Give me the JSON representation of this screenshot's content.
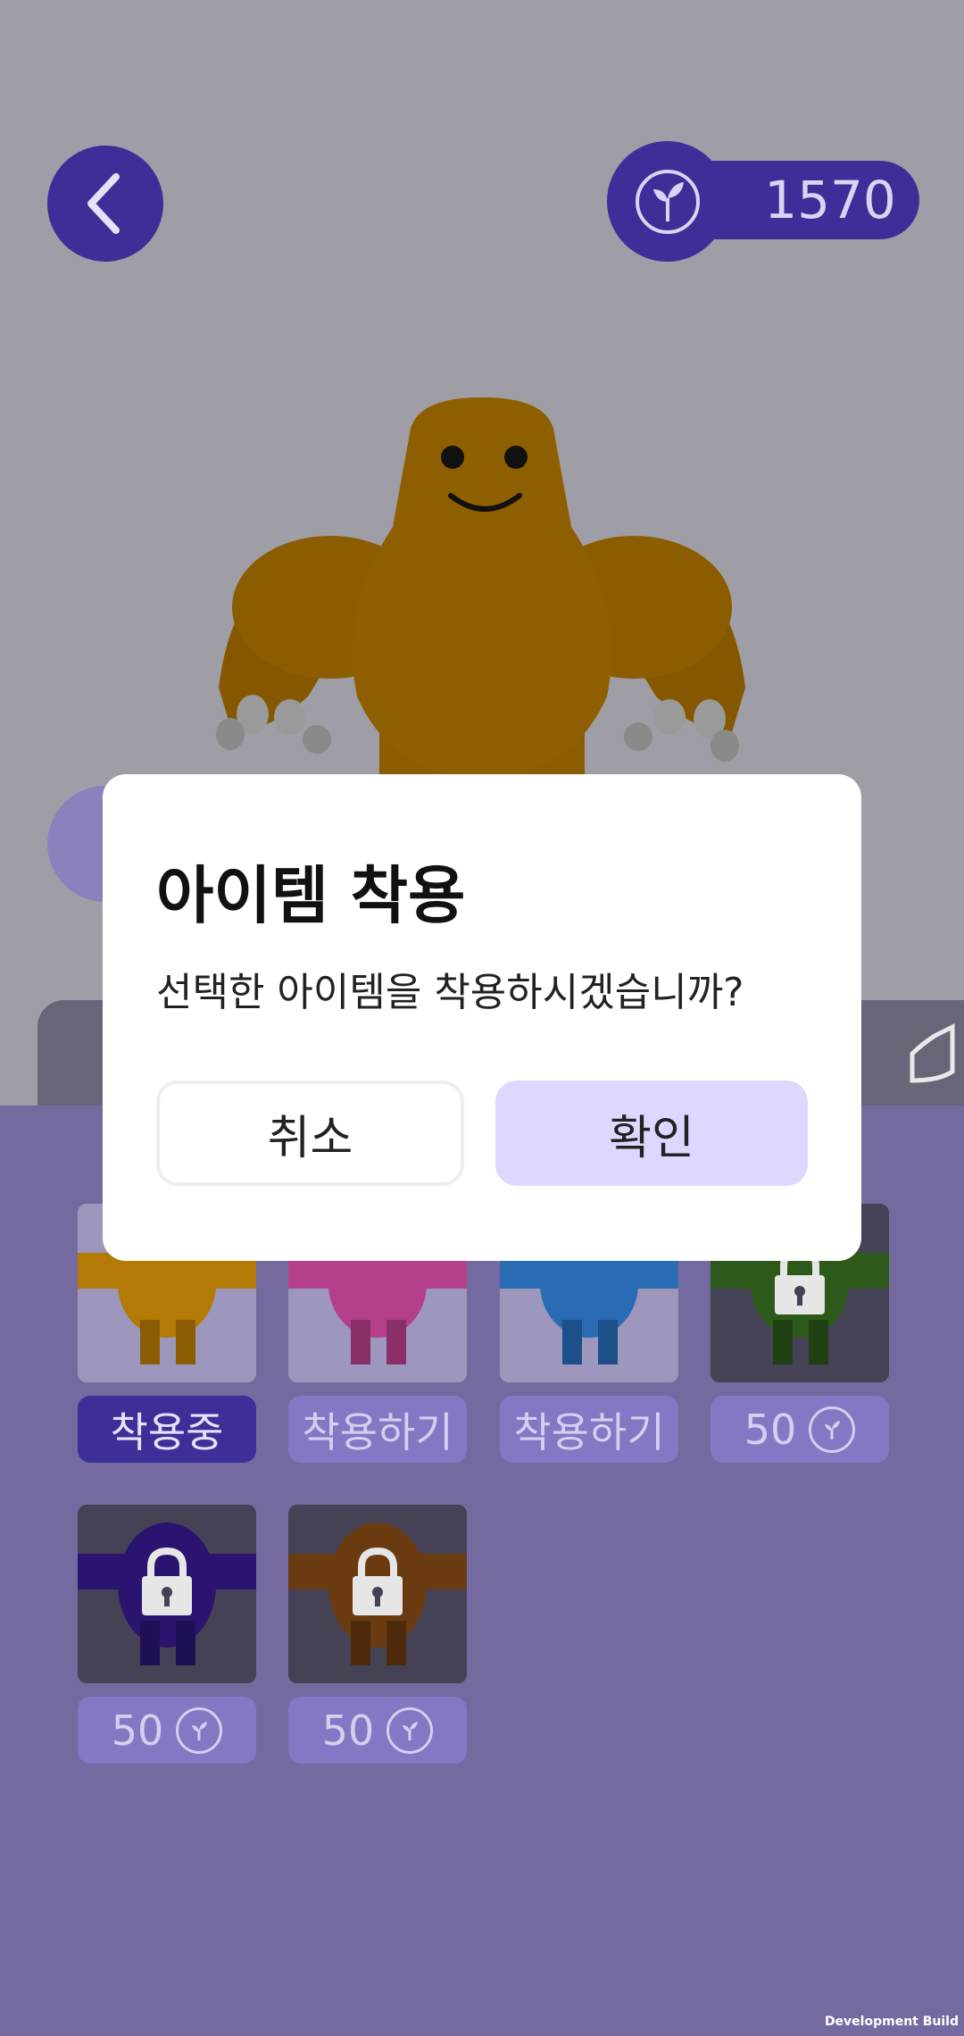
{
  "header": {
    "back_icon": "chevron-left-icon",
    "currency_icon": "sprout-icon",
    "currency_amount": "1570"
  },
  "dialog": {
    "title": "아이템 착용",
    "message": "선택한 아이템을 착용하시겠습니까?",
    "cancel_label": "취소",
    "confirm_label": "확인"
  },
  "items": [
    {
      "label": "착용중",
      "color": "#b47a06",
      "locked": false,
      "state": "equipped"
    },
    {
      "label": "착용하기",
      "color": "#b4408a",
      "locked": false,
      "state": "owned"
    },
    {
      "label": "착용하기",
      "color": "#2a6cb4",
      "locked": false,
      "state": "owned"
    },
    {
      "label": "50",
      "color": "#2d5a1a",
      "locked": true,
      "state": "price"
    },
    {
      "label": "50",
      "color": "#2a1470",
      "locked": true,
      "state": "price"
    },
    {
      "label": "50",
      "color": "#6a3a10",
      "locked": true,
      "state": "price"
    }
  ],
  "footer": {
    "build_label": "Development Build"
  },
  "colors": {
    "accent": "#3e2e98",
    "panel": "#746aa0",
    "character": "#8c5d00",
    "confirm_bg": "#ddd8ff"
  }
}
